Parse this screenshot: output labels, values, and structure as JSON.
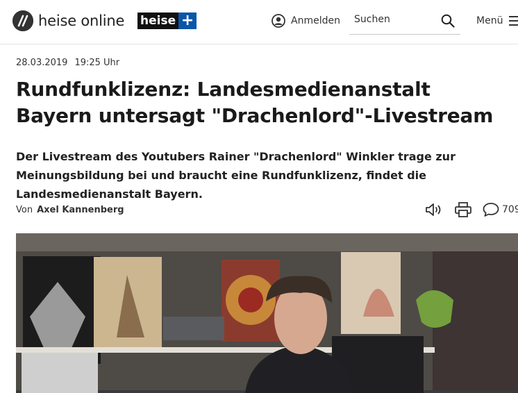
{
  "header": {
    "logo_text": "heise online",
    "plus_word": "heise",
    "plus_sign": "+",
    "login_label": "Anmelden",
    "search_placeholder": "Suchen",
    "menu_label": "Menü"
  },
  "article": {
    "date": "28.03.2019",
    "time": "19:25 Uhr",
    "title": "Rundfunklizenz: Landesmedienanstalt Bayern untersagt \"Drachenlord\"-Livestream",
    "lead": "Der Livestream des Youtubers Rainer \"Drachenlord\" Winkler trage zur Meinungsbildung bei und braucht eine Rundfunklizenz, findet die Landesmedienanstalt Bayern.",
    "byline_prefix": "Von",
    "author": "Axel Kannenberg",
    "comment_count": "709"
  },
  "colors": {
    "plus_blue": "#0a56a8",
    "text": "#1a1a1a"
  },
  "icons": [
    "heise-logo-icon",
    "user-icon",
    "search-icon",
    "menu-icon",
    "speaker-icon",
    "printer-icon",
    "comment-icon"
  ]
}
